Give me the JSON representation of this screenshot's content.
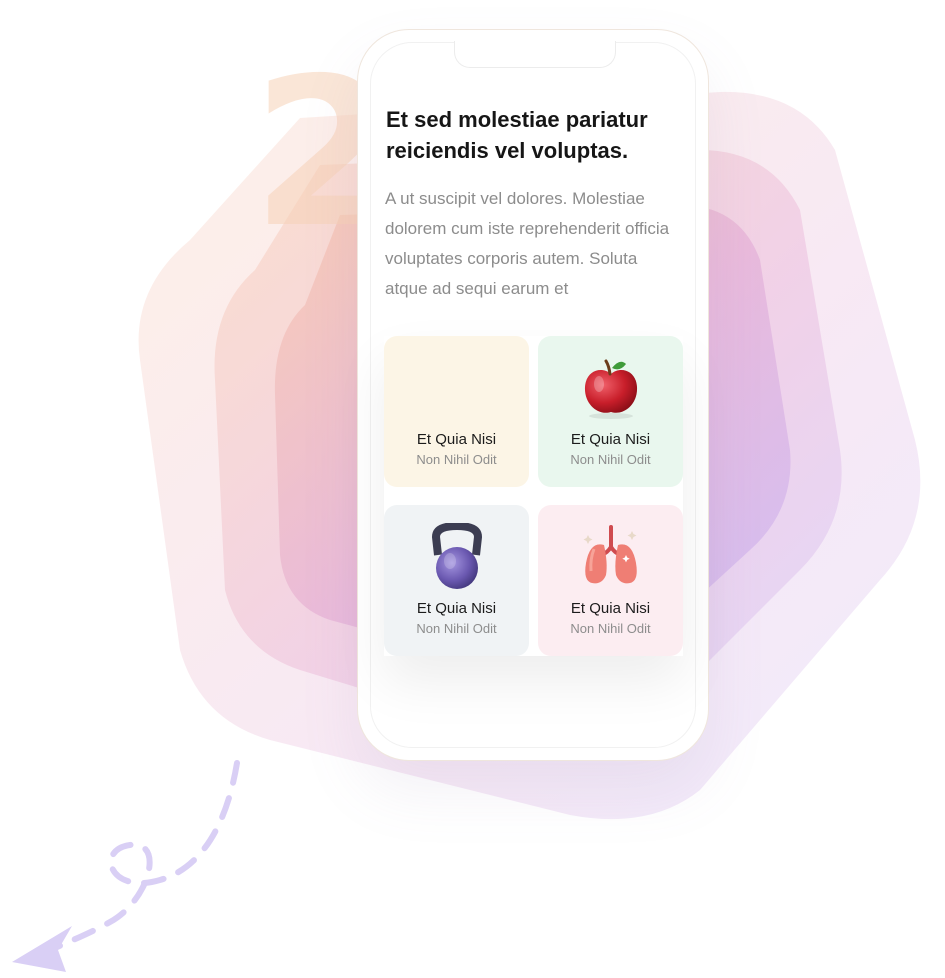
{
  "hero": {
    "step_number": "2",
    "headline": "Et sed molestiae pariatur\n reiciendis vel  voluptas.",
    "body": "A ut suscipit vel dolores. Molestiae dolorem cum iste reprehenderit officia voluptates corporis autem. Soluta atque ad sequi earum et"
  },
  "cards": [
    {
      "title": "Et Quia Nisi",
      "subtitle": "Non Nihil Odit",
      "icon": "none",
      "color": "#fcf5e6"
    },
    {
      "title": "Et Quia Nisi",
      "subtitle": "Non Nihil Odit",
      "icon": "apple-icon",
      "color": "#e9f7ee"
    },
    {
      "title": "Et Quia Nisi",
      "subtitle": "Non Nihil Odit",
      "icon": "kettlebell-icon",
      "color": "#f0f3f5"
    },
    {
      "title": "Et Quia Nisi",
      "subtitle": "Non Nihil Odit",
      "icon": "lungs-icon",
      "color": "#fcedf1"
    }
  ],
  "colors": {
    "accent_purple": "#c9bdf2",
    "accent_peach": "#f7d2b8"
  }
}
